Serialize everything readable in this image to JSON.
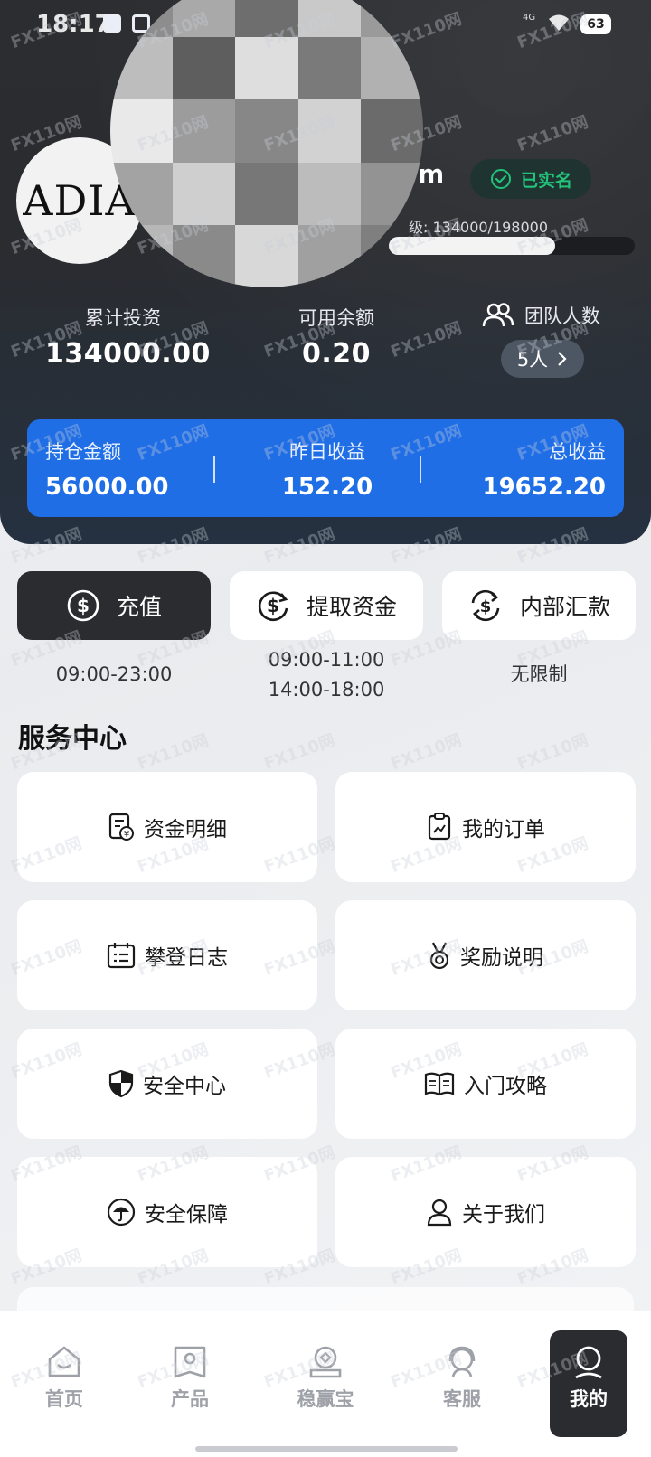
{
  "status_bar": {
    "time": "18:17",
    "network": "4G",
    "battery": "63"
  },
  "profile": {
    "avatar_text": "ADIA",
    "name_tail": "m",
    "verified_label": "已实名",
    "level_text": "级: 134000/198000",
    "level_progress": 0.677
  },
  "stats": {
    "total_invest_label": "累计投资",
    "total_invest_value": "134000.00",
    "balance_label": "可用余额",
    "balance_value": "0.20",
    "team_label": "团队人数",
    "team_value": "5人"
  },
  "holdings": {
    "position_label": "持仓金额",
    "position_value": "56000.00",
    "yesterday_label": "昨日收益",
    "yesterday_value": "152.20",
    "total_label": "总收益",
    "total_value": "19652.20"
  },
  "actions": [
    {
      "label": "充值",
      "hours": "09:00-23:00"
    },
    {
      "label": "提取资金",
      "hours_line1": "09:00-11:00",
      "hours_line2": "14:00-18:00"
    },
    {
      "label": "内部汇款",
      "hours": "无限制"
    }
  ],
  "service_center": {
    "title": "服务中心",
    "items": [
      {
        "label": "资金明细",
        "icon": "fund-detail-icon"
      },
      {
        "label": "我的订单",
        "icon": "order-icon"
      },
      {
        "label": "攀登日志",
        "icon": "calendar-icon"
      },
      {
        "label": "奖励说明",
        "icon": "medal-icon"
      },
      {
        "label": "安全中心",
        "icon": "shield-icon"
      },
      {
        "label": "入门攻略",
        "icon": "book-icon"
      },
      {
        "label": "安全保障",
        "icon": "umbrella-icon"
      },
      {
        "label": "关于我们",
        "icon": "person-icon"
      }
    ]
  },
  "bottom_nav": [
    {
      "label": "首页",
      "icon": "home-icon"
    },
    {
      "label": "产品",
      "icon": "product-icon"
    },
    {
      "label": "稳赢宝",
      "icon": "treasure-icon"
    },
    {
      "label": "客服",
      "icon": "support-icon"
    },
    {
      "label": "我的",
      "icon": "user-icon",
      "active": true
    }
  ],
  "watermark": "FX110网",
  "colors": {
    "header_bg": "#2b2d31",
    "accent_blue": "#1f6ee6",
    "verified_green": "#23c27b",
    "dark_button": "#2b2c30"
  }
}
